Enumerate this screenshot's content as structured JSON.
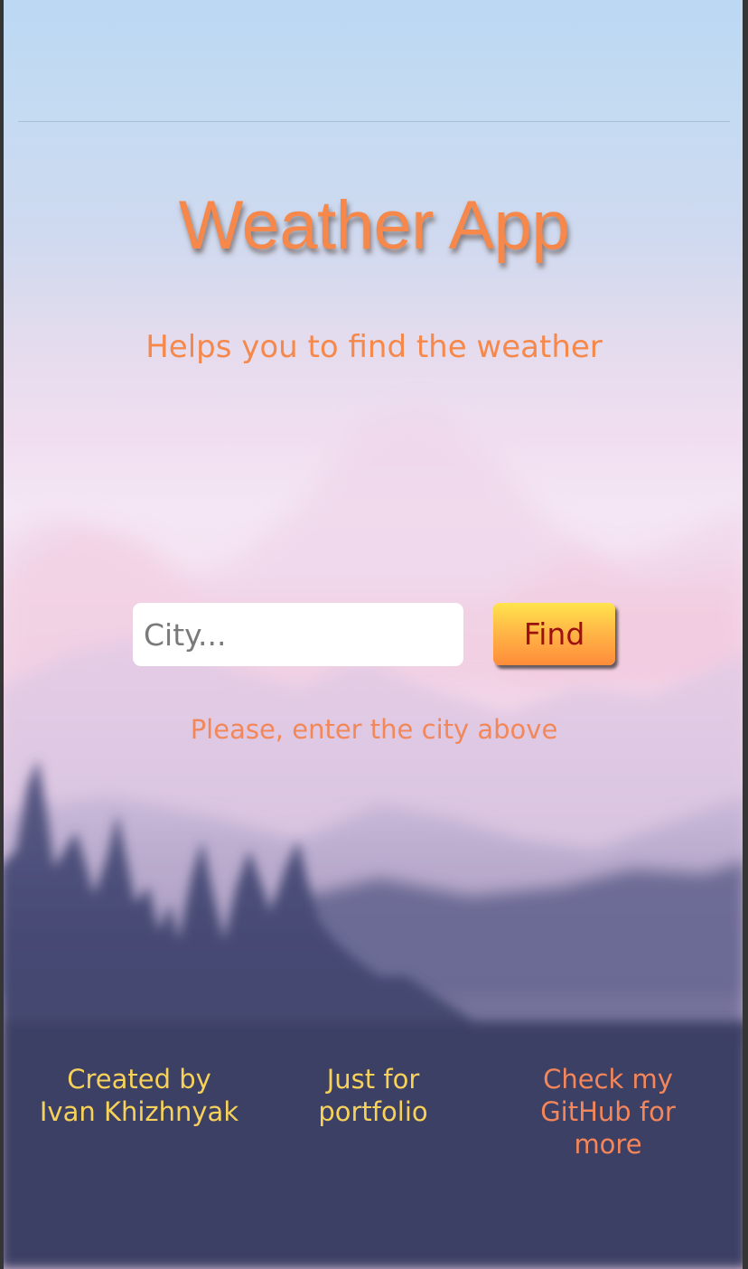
{
  "header": {
    "title": "Weather App",
    "subtitle": "Helps you to find the weather"
  },
  "search": {
    "placeholder": "City...",
    "value": "",
    "button_label": "Find",
    "hint": "Please, enter the city above"
  },
  "footer": {
    "created_by_line1": "Created by",
    "created_by_line2": "Ivan Khizhnyak",
    "portfolio_line1": "Just for",
    "portfolio_line2": "portfolio",
    "github_line1": "Check my",
    "github_line2": "GitHub for",
    "github_line3": "more"
  },
  "colors": {
    "accent_orange": "#f5884a",
    "footer_yellow": "#f7d25a",
    "button_text": "#9c1010",
    "sky_top": "#bcd8f3",
    "forest_dark": "#3d4165"
  }
}
